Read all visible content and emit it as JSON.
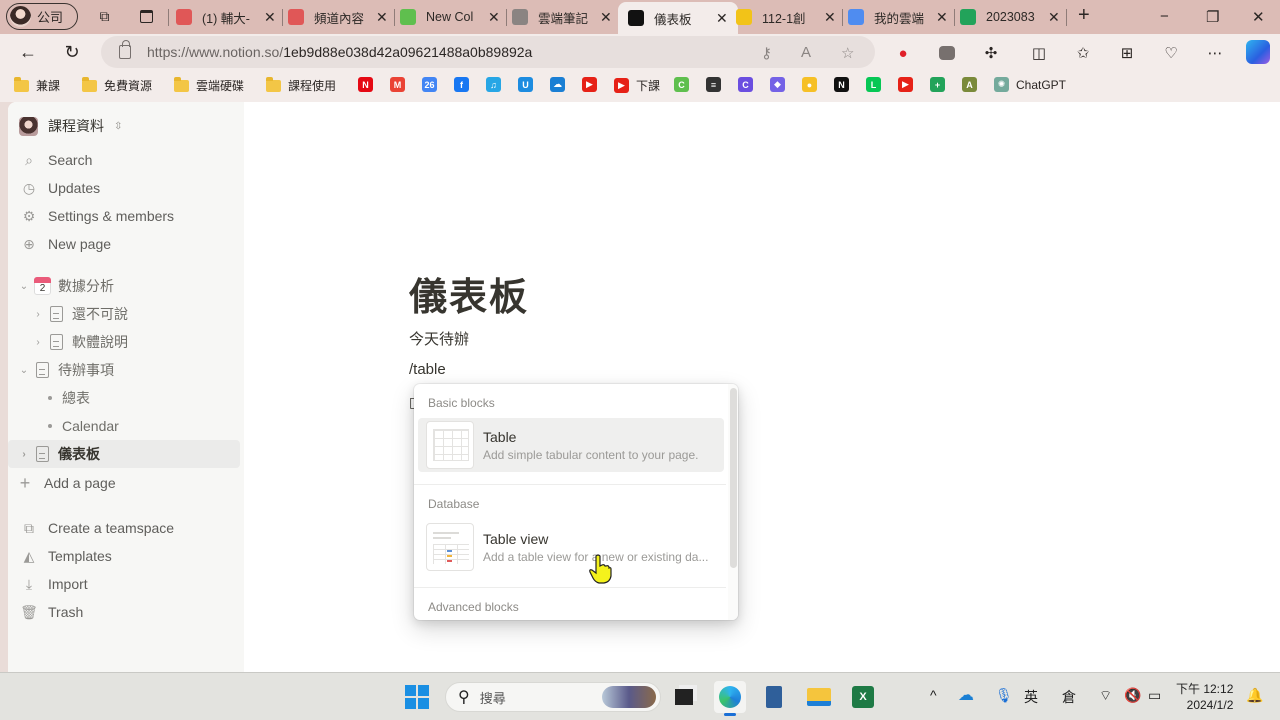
{
  "browser": {
    "profile_label": "公司",
    "tabs": [
      {
        "title": "(1) 輔大-",
        "icon": "youtube-icon",
        "color": "#e05757"
      },
      {
        "title": "頻道內容",
        "icon": "youtube-icon",
        "color": "#e05757"
      },
      {
        "title": "New Col",
        "icon": "collection-icon",
        "color": "#5fbf4e"
      },
      {
        "title": "雲端筆記",
        "icon": "document-icon",
        "color": "#8a8482"
      },
      {
        "title": "儀表板",
        "icon": "notion-icon",
        "color": "#111111",
        "active": true
      },
      {
        "title": "112-1創",
        "icon": "powerbi-icon",
        "color": "#f2c318"
      },
      {
        "title": "我的雲端",
        "icon": "google-drive-icon",
        "color": "#4f8cf0"
      },
      {
        "title": "2023083",
        "icon": "sheets-plus-icon",
        "color": "#22a35a"
      }
    ],
    "new_tab_label": "+",
    "url_host": "https://www.notion.so/",
    "url_path": "1eb9d88e038d42a09621488a0b89892a",
    "bookmarks": [
      {
        "label": "兼課",
        "type": "folder"
      },
      {
        "label": "免費資源",
        "type": "folder"
      },
      {
        "label": "雲端硬碟",
        "type": "folder"
      },
      {
        "label": "課程使用",
        "type": "folder"
      },
      {
        "label": "",
        "icon": "netflix-icon",
        "color": "#e50914",
        "glyph": "N"
      },
      {
        "label": "",
        "icon": "gmail-icon",
        "color": "#ea4335",
        "glyph": "M"
      },
      {
        "label": "",
        "icon": "google-calendar-icon",
        "color": "#4285f4",
        "glyph": "26"
      },
      {
        "label": "",
        "icon": "facebook-icon",
        "color": "#1877f2",
        "glyph": "f"
      },
      {
        "label": "",
        "icon": "music-icon",
        "color": "#27a6e5",
        "glyph": "♫"
      },
      {
        "label": "",
        "icon": "u-app-icon",
        "color": "#1d8ce0",
        "glyph": "U"
      },
      {
        "label": "",
        "icon": "onedrive-icon",
        "color": "#1a7fd4",
        "glyph": "☁"
      },
      {
        "label": "",
        "icon": "youtube-icon",
        "color": "#e62117",
        "glyph": "▶"
      },
      {
        "label": "下課",
        "icon": "youtube-icon",
        "color": "#e62117",
        "glyph": "▶"
      },
      {
        "label": "",
        "icon": "collection-icon",
        "color": "#5fbf4e",
        "glyph": "C"
      },
      {
        "label": "",
        "icon": "document-icon",
        "color": "#333333",
        "glyph": "≡"
      },
      {
        "label": "",
        "icon": "canva-icon",
        "color": "#6b4ee0",
        "glyph": "C"
      },
      {
        "label": "",
        "icon": "copilot-icon",
        "color": "#7462e6",
        "glyph": "◆"
      },
      {
        "label": "",
        "icon": "keep-icon",
        "color": "#f6c026",
        "glyph": "●"
      },
      {
        "label": "",
        "icon": "notion-icon",
        "color": "#111111",
        "glyph": "N"
      },
      {
        "label": "",
        "icon": "line-icon",
        "color": "#06c755",
        "glyph": "L"
      },
      {
        "label": "",
        "icon": "youtube-icon",
        "color": "#e62117",
        "glyph": "▶"
      },
      {
        "label": "",
        "icon": "sheets-plus-icon",
        "color": "#22a35a",
        "glyph": "+"
      },
      {
        "label": "",
        "icon": "app-icon",
        "color": "#7a8a3a",
        "glyph": "A"
      },
      {
        "label": "ChatGPT",
        "icon": "chatgpt-icon",
        "color": "#74aa9c",
        "glyph": "✺"
      }
    ]
  },
  "sidebar": {
    "workspace_name": "課程資料",
    "nav": [
      {
        "label": "Search",
        "icon": "search-icon",
        "glyph": "⌕"
      },
      {
        "label": "Updates",
        "icon": "clock-icon",
        "glyph": "◷"
      },
      {
        "label": "Settings & members",
        "icon": "gear-icon",
        "glyph": "⚙"
      },
      {
        "label": "New page",
        "icon": "plus-circle-icon",
        "glyph": "⊕"
      }
    ],
    "tree": [
      {
        "label": "數據分析",
        "depth": 0,
        "expanded": true,
        "icon": "calendar-icon"
      },
      {
        "label": "還不可說",
        "depth": 1,
        "expanded": false,
        "icon": "page-icon"
      },
      {
        "label": "軟體說明",
        "depth": 1,
        "expanded": false,
        "icon": "page-icon"
      },
      {
        "label": "待辦事項",
        "depth": 0,
        "expanded": true,
        "icon": "page-icon"
      },
      {
        "label": "總表",
        "depth": 1,
        "icon": "bullet"
      },
      {
        "label": "Calendar",
        "depth": 1,
        "icon": "bullet"
      },
      {
        "label": "儀表板",
        "depth": 0,
        "expanded": false,
        "icon": "page-icon",
        "selected": true
      }
    ],
    "add_page": "Add a page",
    "footer": [
      {
        "label": "Create a teamspace",
        "icon": "teamspace-icon",
        "glyph": "⧉"
      },
      {
        "label": "Templates",
        "icon": "templates-icon",
        "glyph": "◭"
      },
      {
        "label": "Import",
        "icon": "download-icon",
        "glyph": "⤓"
      },
      {
        "label": "Trash",
        "icon": "trash-icon",
        "glyph": "🗑"
      }
    ]
  },
  "page": {
    "title": "儀表板",
    "lines": [
      "今天待辦",
      "/table"
    ]
  },
  "slash_menu": {
    "sections": [
      {
        "heading": "Basic blocks",
        "items": [
          {
            "title": "Table",
            "description": "Add simple tabular content to your page.",
            "highlighted": true
          }
        ]
      },
      {
        "heading": "Database",
        "items": [
          {
            "title": "Table view",
            "description": "Add a table view for a new or existing da..."
          }
        ]
      },
      {
        "heading": "Advanced blocks",
        "items": []
      }
    ]
  },
  "taskbar": {
    "search_placeholder": "搜尋",
    "tray": {
      "ime_lang": "英",
      "ime_mode": "倉",
      "time": "下午 12:12",
      "date": "2024/1/2"
    }
  }
}
